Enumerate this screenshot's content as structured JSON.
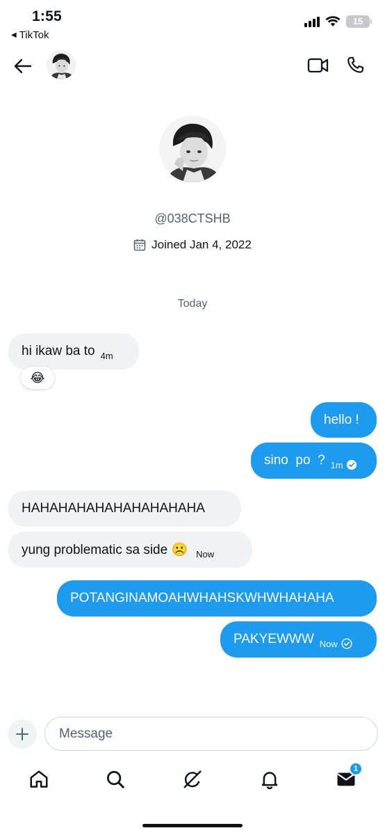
{
  "status_bar": {
    "time": "1:55",
    "back_app": "TikTok",
    "battery": "15"
  },
  "profile": {
    "handle": "@038CTSHB",
    "joined": "Joined Jan 4, 2022"
  },
  "conversation": {
    "day_separator": "Today",
    "messages": [
      {
        "from": "them",
        "text": "hi ikaw ba to",
        "time": "4m",
        "reaction": "😂"
      },
      {
        "from": "me",
        "text": "hello !"
      },
      {
        "from": "me",
        "text": "sino  po  ?",
        "time": "1m",
        "read": true
      },
      {
        "from": "them",
        "text": "HAHAHAHAHAHAHAHAHAHA"
      },
      {
        "from": "them",
        "text": "yung problematic sa side ☹️",
        "time": "Now"
      },
      {
        "from": "me",
        "text": "POTANGINAMOAHWHAHSKWHWHAHAHA"
      },
      {
        "from": "me",
        "text": "PAKYEWWW",
        "time": "Now",
        "read": true
      }
    ]
  },
  "composer": {
    "placeholder": "Message"
  },
  "nav": {
    "items": [
      "home-icon",
      "search-icon",
      "grok-icon",
      "notifications-icon",
      "messages-icon"
    ],
    "messages_badge": "1"
  },
  "colors": {
    "accent": "#1d9bf0",
    "received_bubble": "#eff3f4",
    "secondary_text": "#536471"
  }
}
